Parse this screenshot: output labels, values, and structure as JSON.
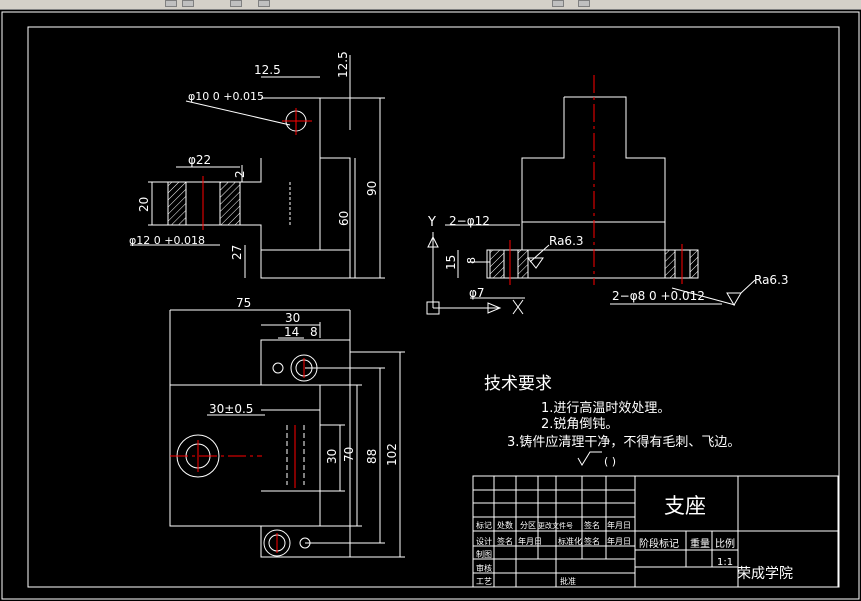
{
  "colors": {
    "background": "#000000",
    "lines": "#ffffff",
    "centerline": "#ff0000",
    "toolbar": "#d4d0c8"
  },
  "front_view": {
    "dim_12_5_h": "12.5",
    "dim_12_5_v": "12.5",
    "hole_tol": "φ10 0 +0.015",
    "counterbore": "φ22",
    "dim_2": "2",
    "dim_20": "20",
    "dim_60": "60",
    "dim_90": "90",
    "bore_tol": "φ12 0 +0.018",
    "dim_27": "27"
  },
  "side_view": {
    "axis_y": "Y",
    "axis_x": "X",
    "hole_2x12": "2−φ12",
    "dim_8": "8",
    "dim_15": "15",
    "dim_7": "φ7",
    "roughness_1": "Ra6.3",
    "pin_tol": "2−φ8 0 +0.012",
    "roughness_2": "Ra6.3"
  },
  "top_view": {
    "dim_75": "75",
    "dim_30_top": "30",
    "dim_14": "14",
    "dim_8": "8",
    "dim_30_tol": "30±0.5",
    "dim_30_v": "30",
    "dim_70": "70",
    "dim_88": "88",
    "dim_102": "102"
  },
  "tech_requirements": {
    "title": "技术要求",
    "items": [
      "1.进行高温时效处理。",
      "2.锐角倒钝。",
      "3.铸件应清理干净，不得有毛刺、飞边。"
    ],
    "roughness_note": "(    )"
  },
  "title_block": {
    "part_name": "支座",
    "school": "荣成学院",
    "scale": "1:1",
    "row1": [
      "标记",
      "处数",
      "分区",
      "更改文件号",
      "签名",
      "年月日"
    ],
    "row2": [
      "设计",
      "签名",
      "年月日",
      "标准化",
      "签名",
      "年月日"
    ],
    "labels": [
      "阶段标记",
      "重量",
      "比例"
    ],
    "other": [
      "制图",
      "审核",
      "工艺",
      "批准"
    ]
  }
}
